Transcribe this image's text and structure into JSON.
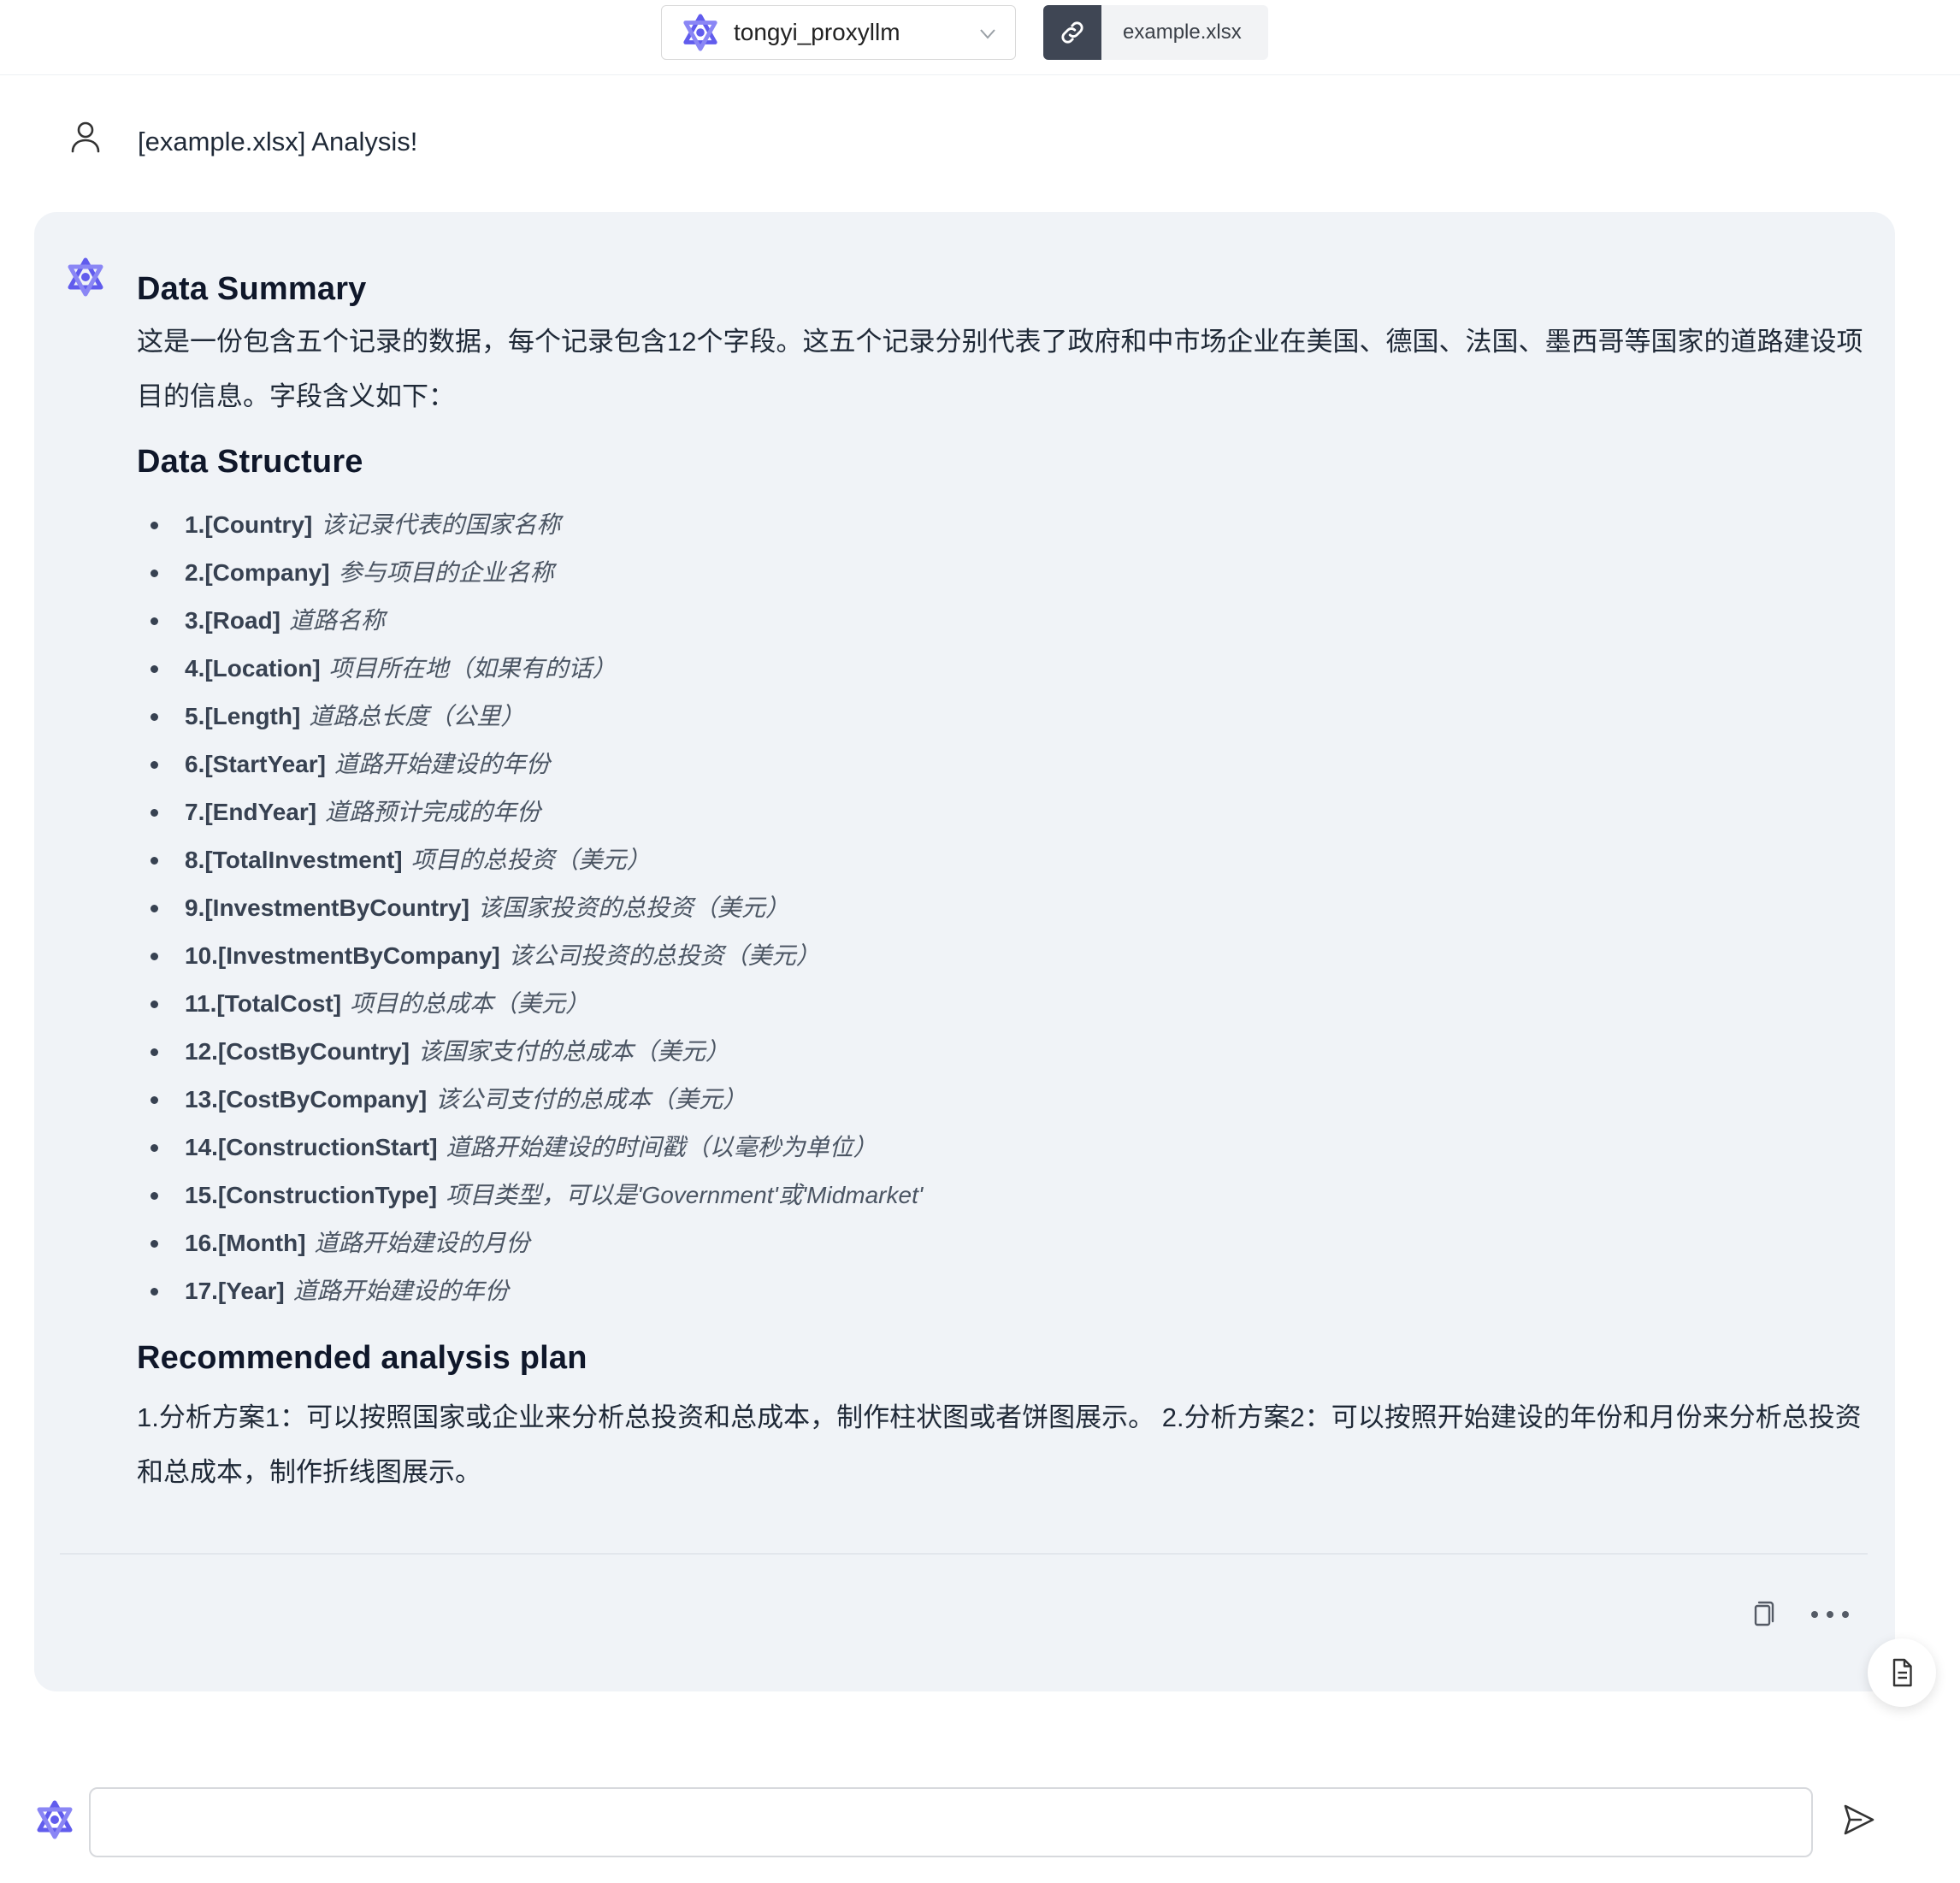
{
  "topbar": {
    "model_name": "tongyi_proxyllm",
    "file_name": "example.xlsx",
    "icons": {
      "model_logo": "qwen-logo-icon",
      "dropdown": "chevron-down-icon",
      "link": "link-icon"
    }
  },
  "conversation": {
    "user_message": "[example.xlsx] Analysis!",
    "assistant": {
      "summary_heading": "Data Summary",
      "summary_text": "这是一份包含五个记录的数据，每个记录包含12个字段。这五个记录分别代表了政府和中市场企业在美国、德国、法国、墨西哥等国家的道路建设项目的信息。字段含义如下：",
      "structure_heading": "Data Structure",
      "fields": [
        {
          "key": "1.[Country]",
          "desc": "该记录代表的国家名称"
        },
        {
          "key": "2.[Company]",
          "desc": "参与项目的企业名称"
        },
        {
          "key": "3.[Road]",
          "desc": "道路名称"
        },
        {
          "key": "4.[Location]",
          "desc": "项目所在地（如果有的话）"
        },
        {
          "key": "5.[Length]",
          "desc": "道路总长度（公里）"
        },
        {
          "key": "6.[StartYear]",
          "desc": "道路开始建设的年份"
        },
        {
          "key": "7.[EndYear]",
          "desc": "道路预计完成的年份"
        },
        {
          "key": "8.[TotalInvestment]",
          "desc": "项目的总投资（美元）"
        },
        {
          "key": "9.[InvestmentByCountry]",
          "desc": "该国家投资的总投资（美元）"
        },
        {
          "key": "10.[InvestmentByCompany]",
          "desc": "该公司投资的总投资（美元）"
        },
        {
          "key": "11.[TotalCost]",
          "desc": "项目的总成本（美元）"
        },
        {
          "key": "12.[CostByCountry]",
          "desc": "该国家支付的总成本（美元）"
        },
        {
          "key": "13.[CostByCompany]",
          "desc": "该公司支付的总成本（美元）"
        },
        {
          "key": "14.[ConstructionStart]",
          "desc": "道路开始建设的时间戳（以毫秒为单位）"
        },
        {
          "key": "15.[ConstructionType]",
          "desc": "项目类型，可以是'Government'或'Midmarket'"
        },
        {
          "key": "16.[Month]",
          "desc": "道路开始建设的月份"
        },
        {
          "key": "17.[Year]",
          "desc": "道路开始建设的年份"
        }
      ],
      "plan_heading": "Recommended analysis plan",
      "plan_text": "1.分析方案1：可以按照国家或企业来分析总投资和总成本，制作柱状图或者饼图展示。 2.分析方案2：可以按照开始建设的年份和月份来分析总投资和总成本，制作折线图展示。",
      "actions": {
        "copy_icon": "copy-icon",
        "more_icon": "more-icon"
      }
    }
  },
  "input": {
    "placeholder": "",
    "value": "",
    "send_icon": "send-icon"
  },
  "floating": {
    "icon": "document-icon"
  },
  "colors": {
    "brand": "#615ced",
    "card_bg": "#f0f3f7",
    "chip_dark": "#3f4654"
  }
}
